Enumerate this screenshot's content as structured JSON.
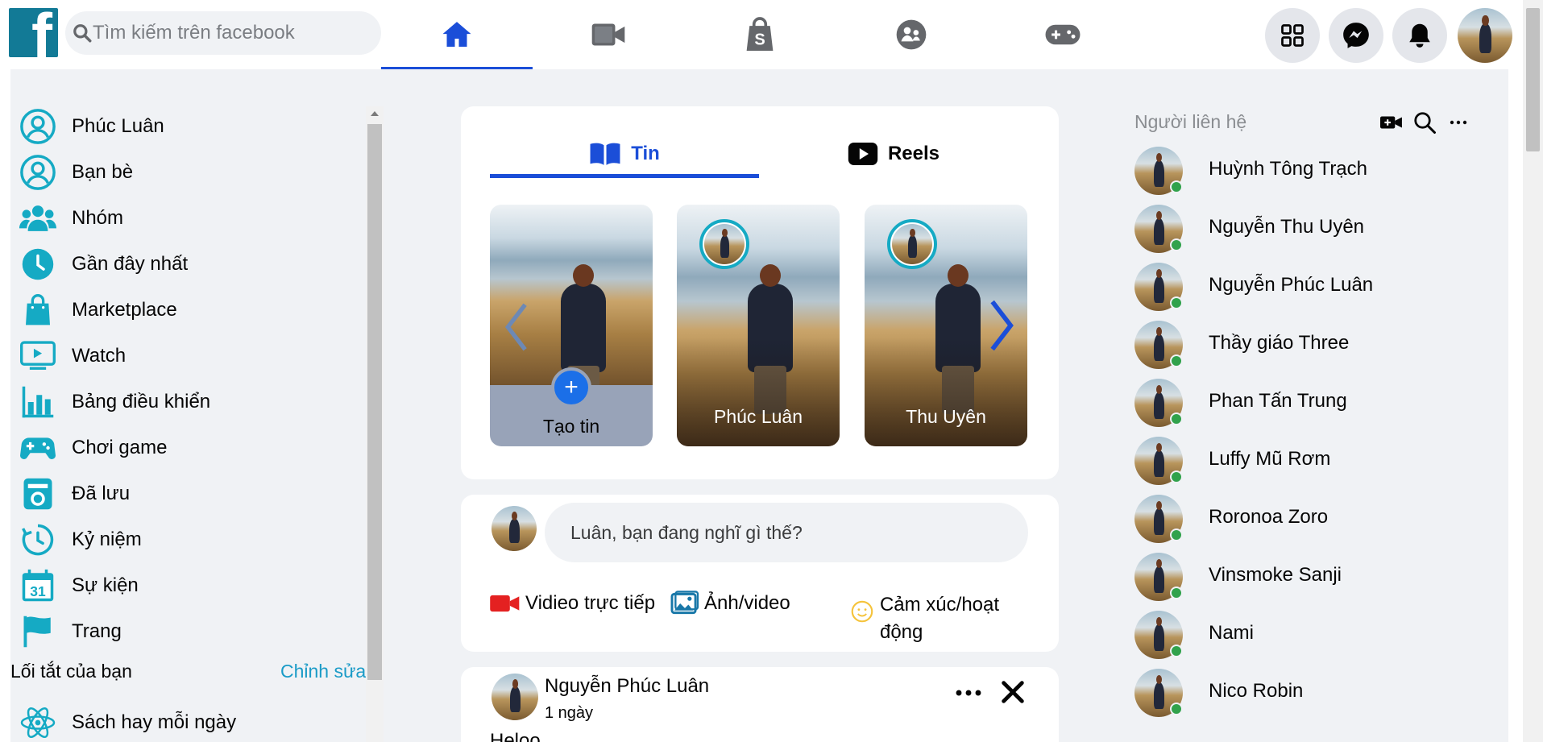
{
  "header": {
    "logo_letter": "f",
    "search_placeholder": "Tìm kiếm trên facebook",
    "nav_tabs": [
      {
        "id": "home",
        "icon": "home-icon",
        "active": true
      },
      {
        "id": "video",
        "icon": "video-icon",
        "active": false
      },
      {
        "id": "marketplace",
        "icon": "shopping-bag-icon",
        "active": false
      },
      {
        "id": "groups",
        "icon": "groups-icon",
        "active": false
      },
      {
        "id": "gaming",
        "icon": "gamepad-icon",
        "active": false
      }
    ],
    "right_buttons": [
      "menu-grid-icon",
      "messenger-icon",
      "bell-icon"
    ],
    "accent_color": "#1b4ed8"
  },
  "sidebar": {
    "items": [
      {
        "label": "Phúc Luân",
        "icon": "user-circle-icon"
      },
      {
        "label": "Bạn bè",
        "icon": "friends-icon"
      },
      {
        "label": "Nhóm",
        "icon": "groups-icon"
      },
      {
        "label": "Gần đây nhất",
        "icon": "clock-icon"
      },
      {
        "label": "Marketplace",
        "icon": "shopping-bag-icon"
      },
      {
        "label": "Watch",
        "icon": "tv-play-icon"
      },
      {
        "label": "Bảng điều khiển",
        "icon": "bar-chart-icon"
      },
      {
        "label": "Chơi game",
        "icon": "gamepad-icon"
      },
      {
        "label": "Đã lưu",
        "icon": "saved-icon"
      },
      {
        "label": "Kỷ niệm",
        "icon": "memories-icon"
      },
      {
        "label": "Sự kiện",
        "icon": "calendar-icon",
        "badge": "31"
      },
      {
        "label": "Trang",
        "icon": "flag-icon"
      }
    ],
    "shortcuts_title": "Lối tắt của bạn",
    "shortcuts_edit": "Chỉnh sửa",
    "shortcuts": [
      {
        "label": "Sách hay mỗi ngày",
        "icon": "react-atom-icon"
      }
    ]
  },
  "stories": {
    "tabs": [
      {
        "label": "Tin",
        "icon": "book-icon",
        "active": true
      },
      {
        "label": "Reels",
        "icon": "play-icon",
        "active": false
      }
    ],
    "cards": [
      {
        "name": "Tạo tin",
        "type": "create"
      },
      {
        "name": "Phúc Luân",
        "type": "story"
      },
      {
        "name": "Thu Uyên",
        "type": "story"
      }
    ]
  },
  "composer": {
    "placeholder": "Luân, bạn đang nghĩ gì thế?",
    "actions": [
      {
        "label": "Vidieo trực tiếp",
        "icon": "live-video-icon"
      },
      {
        "label": "Ảnh/video",
        "icon": "photo-icon"
      },
      {
        "label": "Cảm xúc/hoạt động",
        "icon": "smiley-icon"
      }
    ]
  },
  "post": {
    "author": "Nguyễn Phúc Luân",
    "time": "1 ngày",
    "text": "Heloo"
  },
  "contacts": {
    "title": "Người liên hệ",
    "online_color": "#31a24c",
    "people": [
      "Huỳnh Tông Trạch",
      "Nguyễn Thu Uyên",
      "Nguyễn Phúc Luân",
      "Thầy giáo Three",
      "Phan Tấn Trung",
      "Luffy Mũ Rơm",
      "Roronoa Zoro",
      "Vinsmoke Sanji",
      "Nami",
      "Nico Robin"
    ]
  }
}
